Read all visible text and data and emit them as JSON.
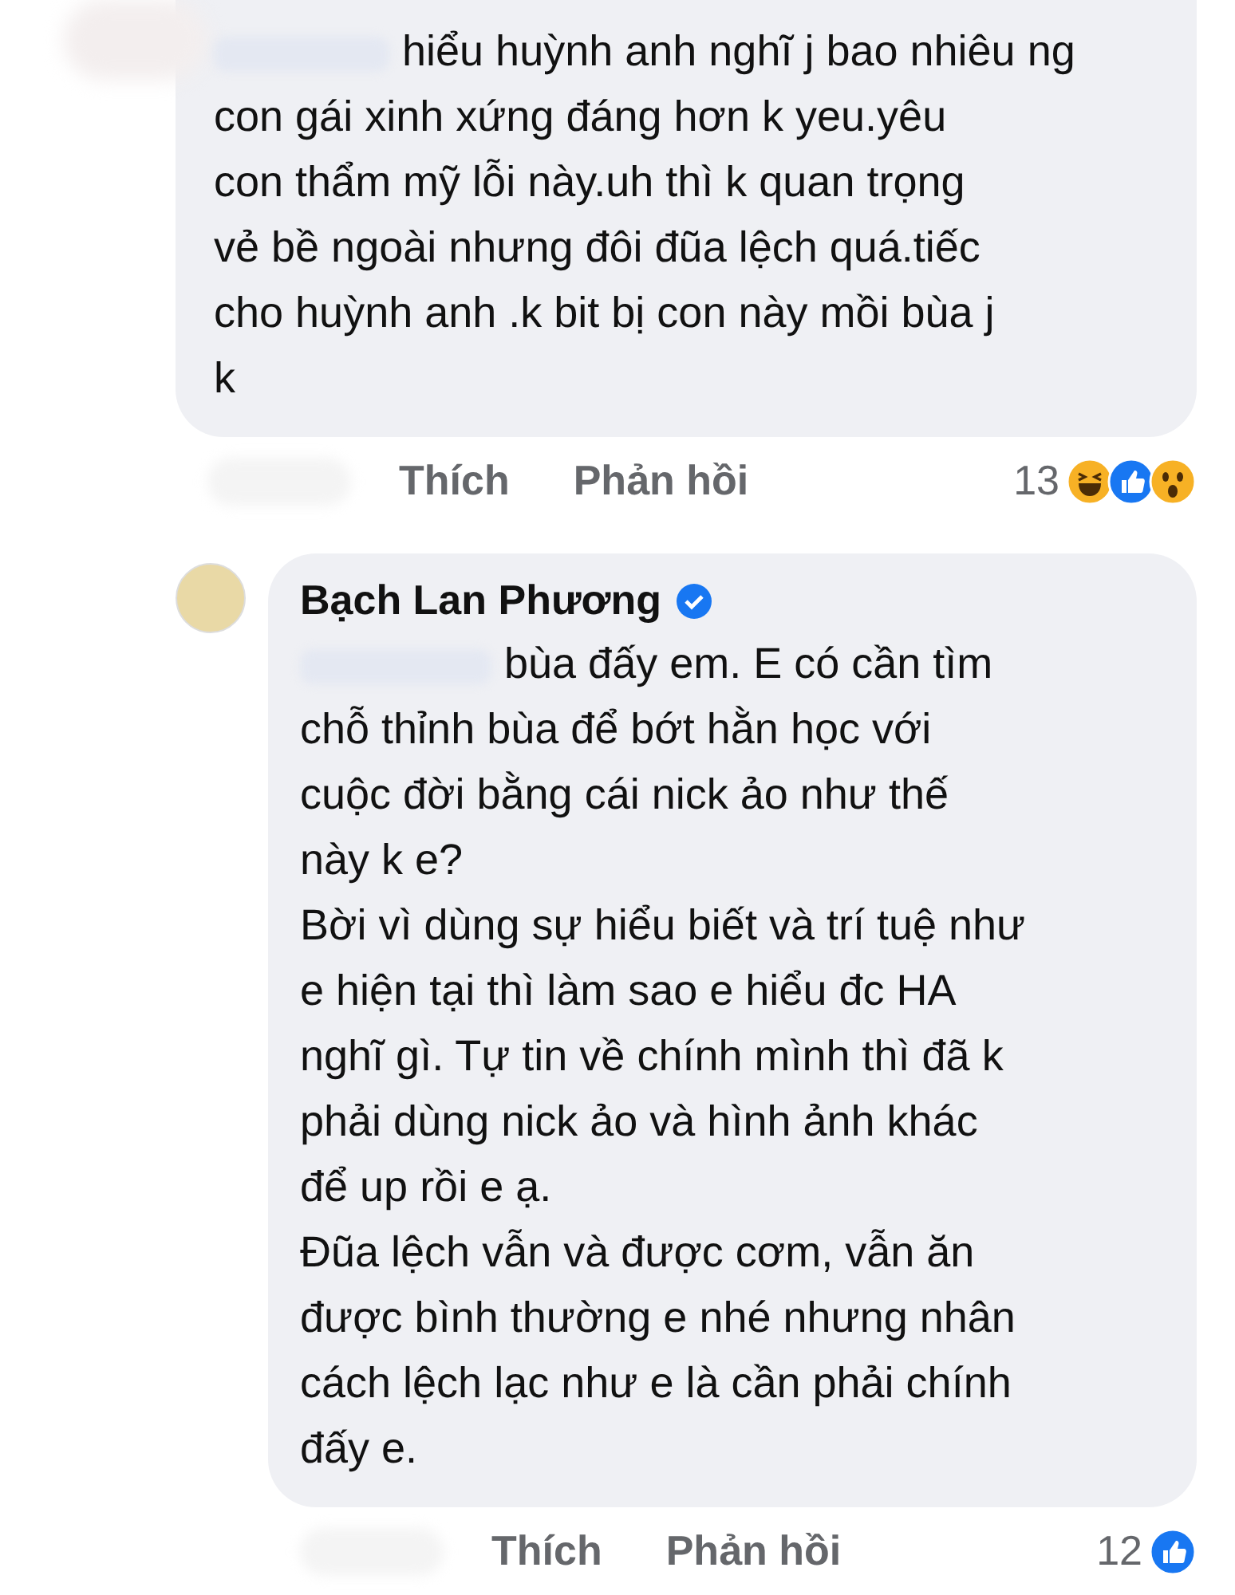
{
  "comments": [
    {
      "paragraphs": [
        {
          "redacted_prefix": true,
          "lines": [
            "hiểu huỳnh anh nghĩ j bao nhiêu ng",
            "con gái xinh xứng đáng hơn k yeu.yêu",
            "con thẩm mỹ lỗi này.uh thì k quan trọng",
            "vẻ bề ngoài nhưng đôi đũa lệch quá.tiếc",
            "cho huỳnh anh .k bit bị con này mồi bùa j",
            "k"
          ]
        }
      ],
      "actions": [
        "Thích",
        "Phản hồi"
      ],
      "reaction_count": "13",
      "reactions": [
        {
          "kind": "haha"
        },
        {
          "kind": "like"
        },
        {
          "kind": "wow"
        }
      ]
    },
    {
      "author": "Bạch Lan Phương",
      "verified": true,
      "paragraphs": [
        {
          "redacted_prefix": true,
          "lines": [
            "bùa đấy em. E có cần tìm",
            "chỗ thỉnh bùa để bớt hằn học với",
            "cuộc đời bằng cái nick ảo như thế",
            "này k e?"
          ]
        },
        {
          "redacted_prefix": false,
          "lines": [
            "Bời vì dùng sự hiểu biết và trí tuệ như",
            "e hiện tại thì làm sao e hiểu đc HA",
            "nghĩ gì. Tự tin về chính mình thì đã k",
            "phải dùng nick ảo và hình ảnh khác",
            "để up rồi e ạ."
          ]
        },
        {
          "redacted_prefix": false,
          "lines": [
            "Đũa lệch vẫn và được cơm, vẫn ăn",
            "được bình thường e nhé nhưng nhân",
            "cách lệch lạc như e là cần phải chính",
            "đấy e."
          ]
        }
      ],
      "actions": [
        "Thích",
        "Phản hồi"
      ],
      "reaction_count": "12",
      "reactions": [
        {
          "kind": "like"
        }
      ]
    }
  ]
}
